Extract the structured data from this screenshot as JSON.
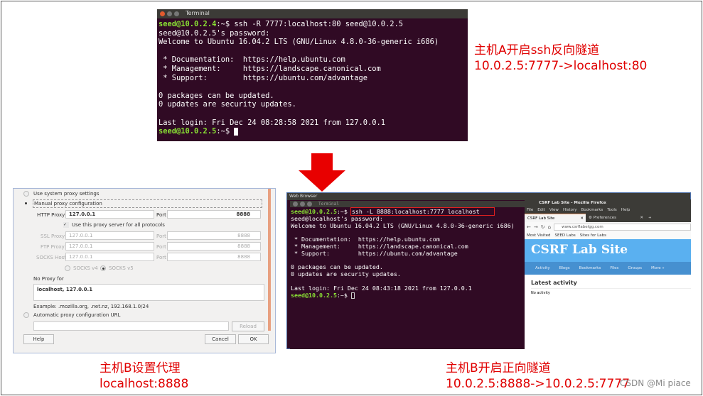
{
  "top_terminal": {
    "title": "Terminal",
    "prompt1": "seed@10.0.2.4",
    "cmd1": ":~$ ssh -R 7777:localhost:80 seed@10.0.2.5",
    "lines": [
      "seed@10.0.2.5's password:",
      "Welcome to Ubuntu 16.04.2 LTS (GNU/Linux 4.8.0-36-generic i686)",
      "",
      " * Documentation:  https://help.ubuntu.com",
      " * Management:     https://landscape.canonical.com",
      " * Support:        https://ubuntu.com/advantage",
      "",
      "0 packages can be updated.",
      "0 updates are security updates.",
      "",
      "Last login: Fri Dec 24 08:28:58 2021 from 127.0.0.1"
    ],
    "prompt2": "seed@10.0.2.5",
    "cmd2": ":~$ "
  },
  "caption_a": {
    "line1": "主机A开启ssh反向隧道",
    "line2": "10.0.2.5:7777->localhost:80"
  },
  "caption_b1": {
    "line1": "主机B设置代理",
    "line2": "localhost:8888"
  },
  "caption_b2": {
    "line1": "主机B开启正向隧道",
    "line2": "10.0.2.5:8888->10.0.2.5:7777"
  },
  "watermark": "CSDN @Mi piace",
  "arrow_color": "#e80000",
  "proxy_dialog": {
    "system": "Use system proxy settings",
    "manual": "Manual proxy configuration",
    "http_label": "HTTP Proxy",
    "http_value": "127.0.0.1",
    "port_label": "Port",
    "http_port": "8888",
    "use_all": "Use this proxy server for all protocols",
    "ssl_label": "SSL Proxy",
    "ssl_value": "127.0.0.1",
    "ssl_port": "8888",
    "ftp_label": "FTP Proxy",
    "ftp_value": "127.0.0.1",
    "ftp_port": "8888",
    "socks_label": "SOCKS Host",
    "socks_value": "127.0.0.1",
    "socks_port": "8888",
    "socks4": "SOCKS v4",
    "socks5": "SOCKS v5",
    "no_proxy_label": "No Proxy for",
    "no_proxy_value": "localhost, 127.0.0.1",
    "example": "Example: .mozilla.org, .net.nz, 192.168.1.0/24",
    "auto": "Automatic proxy configuration URL",
    "reload": "Reload",
    "help": "Help",
    "cancel": "Cancel",
    "ok": "OK"
  },
  "web_browser": {
    "title": "Web Browser",
    "terminal": {
      "title": "Terminal",
      "prompt1": "seed@10.0.2.5",
      "cmd1": "ssh -L 8888:localhost:7777 localhost",
      "pre1": ":~$ ",
      "lines": [
        "seed@localhost's password:",
        "Welcome to Ubuntu 16.04.2 LTS (GNU/Linux 4.8.0-36-generic i686)",
        "",
        " * Documentation:  https://help.ubuntu.com",
        " * Management:     https://landscape.canonical.com",
        " * Support:        https://ubuntu.com/advantage",
        "",
        "0 packages can be updated.",
        "0 updates are security updates.",
        "",
        "Last login: Fri Dec 24 08:43:18 2021 from 127.0.0.1"
      ],
      "prompt2": "seed@10.0.2.5",
      "cmd2": ":~$ "
    },
    "firefox": {
      "title": "CSRF Lab Site - Mozilla Firefox",
      "menu": [
        "File",
        "Edit",
        "View",
        "History",
        "Bookmarks",
        "Tools",
        "Help"
      ],
      "tabs": [
        "CSRF Lab Site",
        "Preferences"
      ],
      "url": "www.csrflabelgg.com",
      "bookmarks": [
        "Most Visited",
        "SEED Labs",
        "Sites for Labs"
      ],
      "site_title": "CSRF Lab Site",
      "nav": [
        "Activity",
        "Blogs",
        "Bookmarks",
        "Files",
        "Groups",
        "More »"
      ],
      "heading": "Latest activity",
      "empty": "No activity"
    }
  }
}
